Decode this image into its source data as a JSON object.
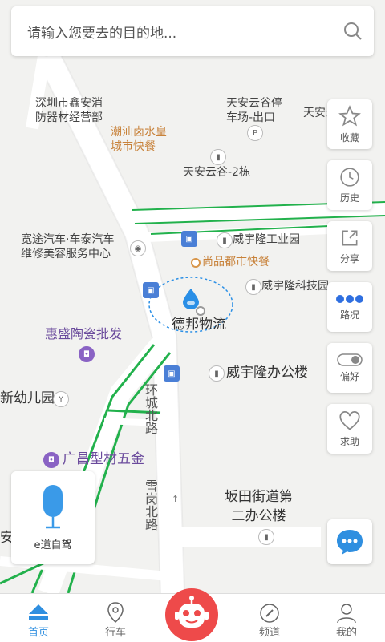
{
  "search": {
    "placeholder": "请输入您要去的目的地..."
  },
  "map": {
    "pois": [
      {
        "name": "shenzhen-xinan-poi",
        "text": "深圳市鑫安消\n防器材经营部"
      },
      {
        "name": "tianan-parking-poi",
        "text": "天安云谷停\n车场-出口"
      },
      {
        "name": "tianan-right-poi",
        "text": "天安云"
      },
      {
        "name": "chaoshan-poi",
        "text": "潮汕卤水皇\n城市快餐"
      },
      {
        "name": "tianan-2-poi",
        "text": "天安云谷-2栋"
      },
      {
        "name": "kuantu-poi",
        "text": "宽途汽车·车泰汽车\n维修美容服务中心"
      },
      {
        "name": "weiyulong-industrial-poi",
        "text": "威宇隆工业园"
      },
      {
        "name": "shangpin-poi",
        "text": "尚品都市快餐"
      },
      {
        "name": "weiyulong-tech-poi",
        "text": "威宇隆科技园"
      },
      {
        "name": "debang-poi",
        "text": "德邦物流"
      },
      {
        "name": "huisheng-poi",
        "text": "惠盛陶瓷批发"
      },
      {
        "name": "weiyulong-office-poi",
        "text": "威宇隆办公楼"
      },
      {
        "name": "kindergarten-poi",
        "text": "新幼儿园"
      },
      {
        "name": "guangchang-poi",
        "text": "广昌型材五金"
      },
      {
        "name": "bantian-poi",
        "text": "坂田街道第\n二办公楼"
      },
      {
        "name": "left-edge-poi",
        "text": "安"
      }
    ],
    "roads": [
      {
        "name": "huancheng-north-road-label",
        "text": "环城北路"
      },
      {
        "name": "xuegang-north-road-label",
        "text": "雪岗北路"
      }
    ]
  },
  "side_buttons": [
    {
      "name": "favorites-button",
      "icon": "star-icon",
      "label": "收藏"
    },
    {
      "name": "history-button",
      "icon": "clock-icon",
      "label": "历史"
    },
    {
      "name": "share-button",
      "icon": "share-icon",
      "label": "分享"
    },
    {
      "name": "traffic-button",
      "icon": "dots-icon",
      "label": "路况"
    },
    {
      "name": "preference-button",
      "icon": "toggle-icon",
      "label": "偏好"
    },
    {
      "name": "help-button",
      "icon": "heart-icon",
      "label": "求助"
    }
  ],
  "voice": {
    "label": "e道自驾",
    "icon": "microphone-icon"
  },
  "tabs": [
    {
      "name": "tab-home",
      "icon": "home-icon",
      "label": "首页",
      "active": true
    },
    {
      "name": "tab-drive",
      "icon": "location-pin-icon",
      "label": "行车",
      "active": false
    },
    {
      "name": "tab-channel",
      "icon": "compass-icon",
      "label": "频道",
      "active": false
    },
    {
      "name": "tab-mine",
      "icon": "user-icon",
      "label": "我的",
      "active": false
    }
  ],
  "colors": {
    "accent": "#2f8fe0",
    "robot": "#ee4a4a",
    "traffic_green": "#22b14c",
    "location_blue": "#2a8fe6"
  }
}
